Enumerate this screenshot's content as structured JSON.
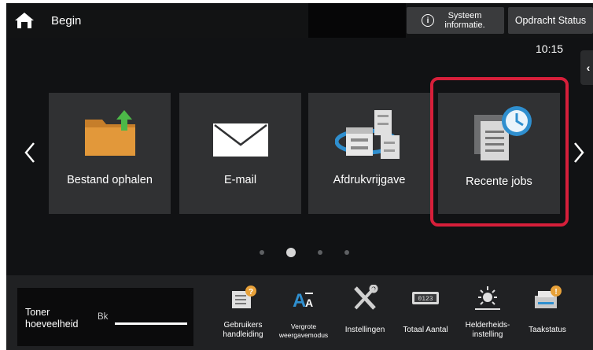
{
  "header": {
    "home_label": "Begin",
    "system_info_label": "Systeem informatie.",
    "job_status_label": "Opdracht Status",
    "time": "10:15"
  },
  "tiles": [
    {
      "label": "Bestand ophalen",
      "icon": "folder-upload-icon"
    },
    {
      "label": "E-mail",
      "icon": "envelope-icon"
    },
    {
      "label": "Afdrukvrijgave",
      "icon": "print-release-icon"
    },
    {
      "label": "Recente jobs",
      "icon": "recent-jobs-icon"
    }
  ],
  "pagination": {
    "pages": 4,
    "current": 2
  },
  "toner": {
    "label": "Toner hoeveelheid",
    "color_code": "Bk",
    "level_percent": 100
  },
  "toolbar": [
    {
      "label": "Gebruikers handleiding",
      "icon": "user-manual-icon"
    },
    {
      "label": "Vergrote weergavemodus",
      "icon": "enlarge-text-icon"
    },
    {
      "label": "Instellingen",
      "icon": "tools-icon"
    },
    {
      "label": "Totaal Aantal",
      "icon": "counter-icon"
    },
    {
      "label": "Helderheids-instelling",
      "icon": "brightness-icon"
    },
    {
      "label": "Taakstatus",
      "icon": "task-status-icon"
    }
  ],
  "colors": {
    "highlight": "#d71f3a",
    "accent_blue": "#2f8fcf",
    "folder_orange": "#e2983a",
    "upload_green": "#4cb848"
  }
}
